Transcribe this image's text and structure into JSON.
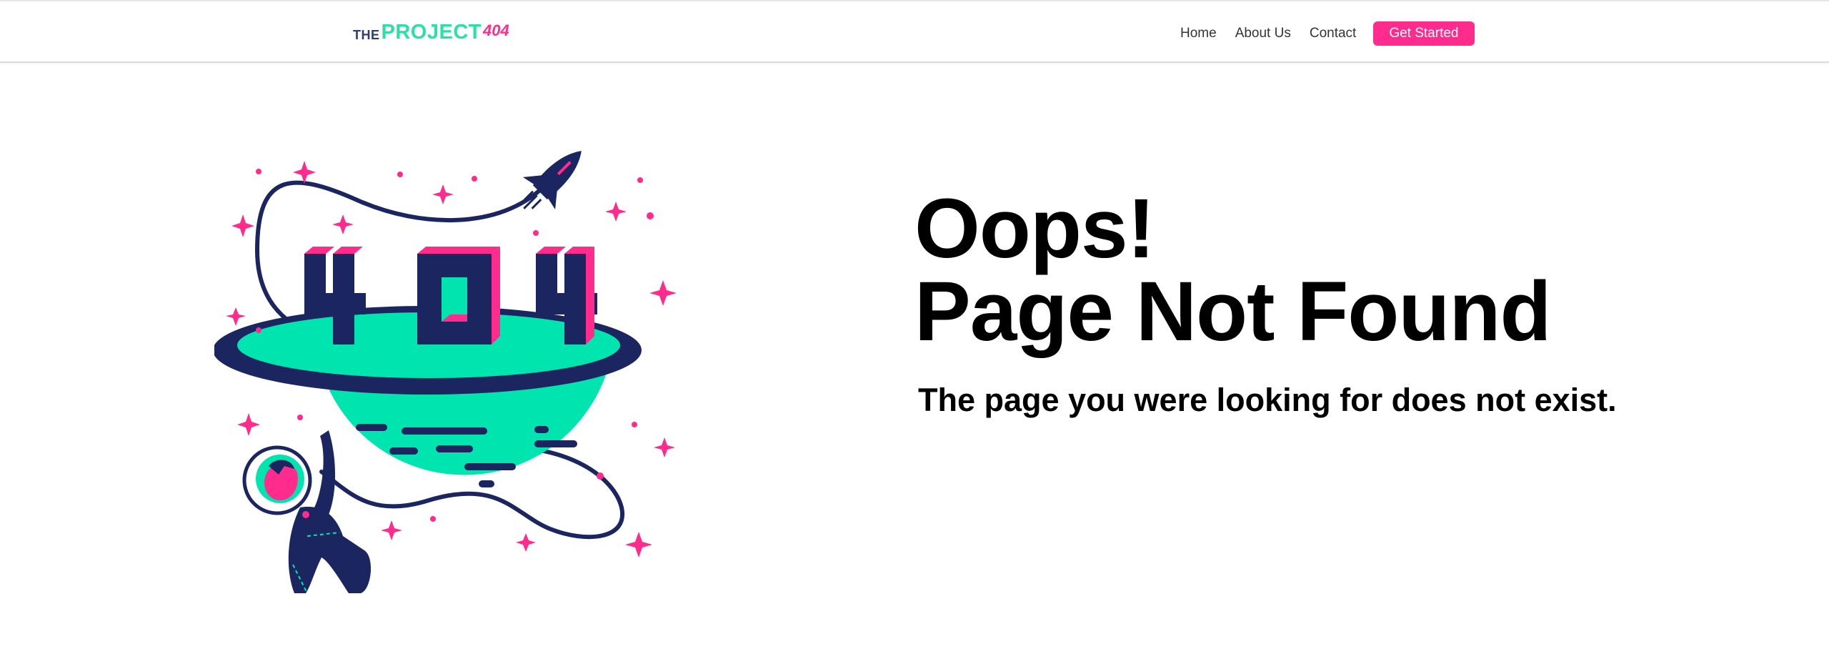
{
  "brand": {
    "logo_the": "THE",
    "logo_project": "PROJECT",
    "logo_404": "404",
    "colors": {
      "navy": "#1b2660",
      "mint": "#00e5b0",
      "pink": "#ff2c8d"
    }
  },
  "nav": {
    "links": [
      "Home",
      "About Us",
      "Contact"
    ],
    "cta_label": "Get Started"
  },
  "main": {
    "headline_line1": "Oops!",
    "headline_line2": "Page Not Found",
    "subheadline": "The page you were looking for does not exist.",
    "illustration": {
      "number_text": "404",
      "icons": [
        "planet-icon",
        "rocket-icon",
        "astronaut-icon",
        "sparkle-star-icon"
      ]
    }
  }
}
